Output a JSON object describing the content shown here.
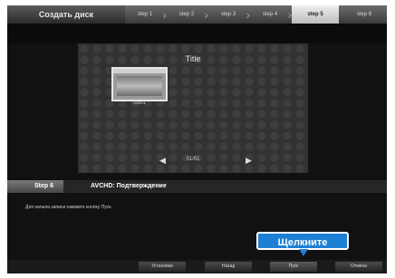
{
  "app": {
    "title": "Создать диск"
  },
  "steps": [
    "step 1",
    "step 2",
    "step 3",
    "step 4",
    "step 5",
    "step 6"
  ],
  "active_step_index": 4,
  "preview": {
    "disc_title": "Title",
    "thumbnail_label": "00001",
    "page_indicator": "01/01"
  },
  "info": {
    "step_label": "Step 6",
    "title": "AVCHD: Подтверждение",
    "instruction": "Для начала записи нажмите кнопку Пуск."
  },
  "callout": {
    "text": "Щелкните"
  },
  "buttons": {
    "settings": "Установки",
    "back": "Назад",
    "start": "Пуск",
    "cancel": "Отмена"
  }
}
